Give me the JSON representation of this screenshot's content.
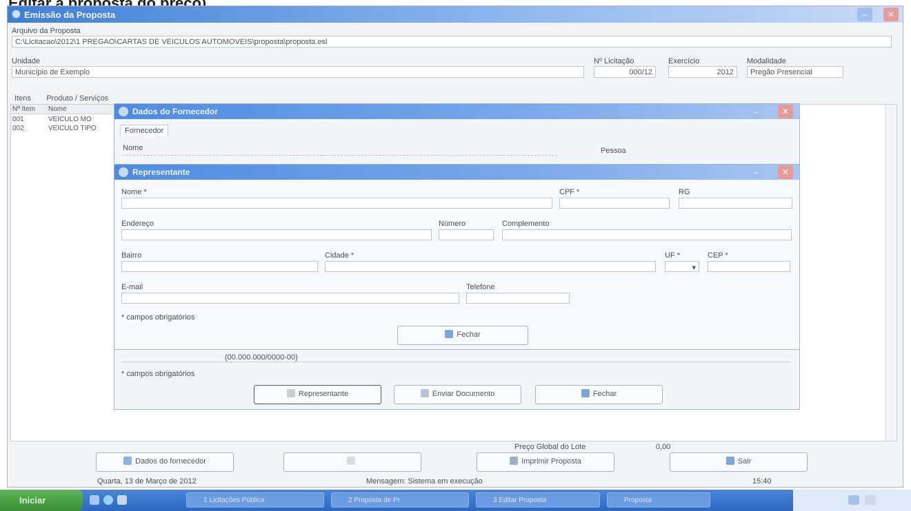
{
  "caption": "Editar a proposta do preço).",
  "main_window": {
    "title": "Emissão da Proposta",
    "archive_label": "Arquivo da Proposta",
    "archive_value": "C:\\Licitacao\\2012\\1 PREGAO\\CARTAS DE VEICULOS AUTOMOVEIS\\proposta\\proposta.esl",
    "entity_label": "Unidade",
    "entity_value": "Município de Exemplo",
    "licitacao_label": "Nº Licitação",
    "licitacao_value": "000/12",
    "exercicio_label": "Exercício",
    "exercicio_value": "2012",
    "modalidade_label": "Modalidade",
    "modalidade_value": "Pregão Presencial",
    "tabs": [
      "Itens",
      "Produto / Serviços"
    ],
    "list_headers": [
      "Nº Item",
      "Nome"
    ],
    "list_rows": [
      {
        "num": "001",
        "name": "VEICULO MO"
      },
      {
        "num": "002",
        "name": "VEICULO TIPO"
      }
    ],
    "total_label": "Preço Global do Lote",
    "total_value": "0,00",
    "buttons": {
      "supplier": "Dados do fornecedor",
      "disabled": "",
      "save": "Imprimir Proposta",
      "exit": "Sair"
    },
    "status_date": "Quarta, 13 de Março de 2012",
    "status_msg": "Mensagem: Sistema em execução",
    "status_time": "15:40"
  },
  "fornecedor_window": {
    "title": "Dados do Fornecedor",
    "tab": "Fornecedor",
    "name_label": "Nome",
    "pessoa_label": "Pessoa",
    "cpf_cnpj_value": "(00.000.000/0000-00)",
    "note": "* campos obrigatórios",
    "buttons": {
      "representative": "Representante",
      "send": "Enviar Documento",
      "close": "Fechar"
    }
  },
  "rep_window": {
    "title": "Representante",
    "fields": {
      "nome": "Nome *",
      "cpf": "CPF *",
      "rg": "RG",
      "endereco": "Endereço",
      "numero": "Número",
      "complemento": "Complemento",
      "bairro": "Bairro",
      "cidade": "Cidade *",
      "uf": "UF *",
      "cep": "CEP *",
      "email": "E-mail",
      "telefone": "Telefone"
    },
    "note": "* campos obrigatórios",
    "close_button": "Fechar"
  },
  "taskbar": {
    "start": "Iniciar",
    "tasks": [
      "1 Licitações Pública",
      "2 Proposta de Pr",
      "3 Editar Proposta",
      "Proposta"
    ]
  },
  "colors": {
    "titlebar": "#3f7fd4",
    "taskbar": "#2e66c0",
    "start": "#3a8d34"
  }
}
